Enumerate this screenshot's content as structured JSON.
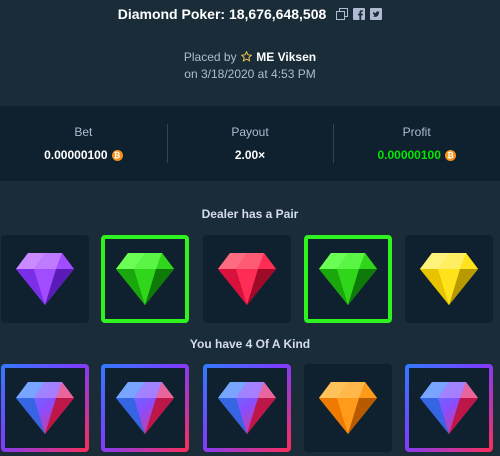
{
  "header": {
    "title": "Diamond Poker: 18,676,648,508",
    "icons": [
      "copy-icon",
      "facebook-icon",
      "twitter-icon"
    ]
  },
  "placed": {
    "prefix": "Placed by",
    "badge": "ME",
    "user": "Viksen",
    "date": "on 3/18/2020 at 4:53 PM"
  },
  "stats": {
    "bet_label": "Bet",
    "bet_value": "0.00000100",
    "payout_label": "Payout",
    "payout_value": "2.00×",
    "profit_label": "Profit",
    "profit_value": "0.00000100",
    "coin_symbol": "₿"
  },
  "dealer": {
    "title": "Dealer has a Pair",
    "gems": [
      {
        "color": "purple",
        "highlight": "none"
      },
      {
        "color": "green",
        "highlight": "win"
      },
      {
        "color": "red",
        "highlight": "none"
      },
      {
        "color": "green",
        "highlight": "win"
      },
      {
        "color": "yellow",
        "highlight": "none"
      }
    ]
  },
  "player": {
    "title": "You have 4 Of A Kind",
    "gems": [
      {
        "color": "multi",
        "highlight": "multi"
      },
      {
        "color": "multi",
        "highlight": "multi"
      },
      {
        "color": "multi",
        "highlight": "multi"
      },
      {
        "color": "orange",
        "highlight": "none"
      },
      {
        "color": "multi",
        "highlight": "multi"
      }
    ]
  },
  "colors": {
    "background": "#1a2c38",
    "panel": "#0f212e",
    "win_border": "#2ff31e",
    "profit": "#00e701",
    "coin": "#f7931a"
  }
}
